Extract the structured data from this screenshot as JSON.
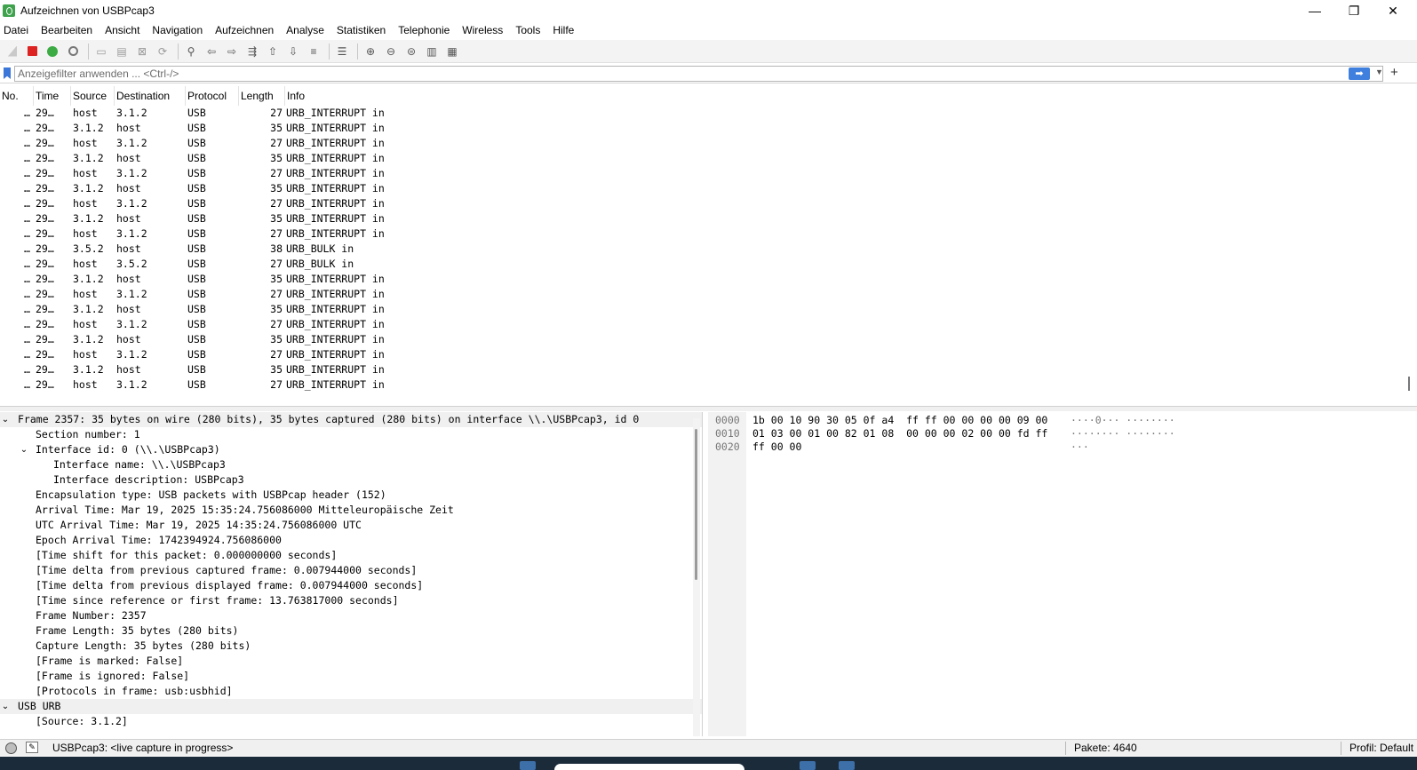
{
  "window": {
    "title": "Aufzeichnen von USBPcap3",
    "minimize": "—",
    "maximize": "❐",
    "close": "✕"
  },
  "menu": [
    "Datei",
    "Bearbeiten",
    "Ansicht",
    "Navigation",
    "Aufzeichnen",
    "Analyse",
    "Statistiken",
    "Telephonie",
    "Wireless",
    "Tools",
    "Hilfe"
  ],
  "filter": {
    "placeholder": "Anzeigefilter anwenden ... <Ctrl-/>",
    "apply": "➡",
    "dropdown": "▼",
    "add": "+"
  },
  "packet_list": {
    "columns": [
      "No.",
      "Time",
      "Source",
      "Destination",
      "Protocol",
      "Length",
      "Info"
    ],
    "rows": [
      {
        "no": "…",
        "time": "29…",
        "src": "host",
        "dst": "3.1.2",
        "proto": "USB",
        "len": "27",
        "info": "URB_INTERRUPT in"
      },
      {
        "no": "…",
        "time": "29…",
        "src": "3.1.2",
        "dst": "host",
        "proto": "USB",
        "len": "35",
        "info": "URB_INTERRUPT in"
      },
      {
        "no": "…",
        "time": "29…",
        "src": "host",
        "dst": "3.1.2",
        "proto": "USB",
        "len": "27",
        "info": "URB_INTERRUPT in"
      },
      {
        "no": "…",
        "time": "29…",
        "src": "3.1.2",
        "dst": "host",
        "proto": "USB",
        "len": "35",
        "info": "URB_INTERRUPT in"
      },
      {
        "no": "…",
        "time": "29…",
        "src": "host",
        "dst": "3.1.2",
        "proto": "USB",
        "len": "27",
        "info": "URB_INTERRUPT in"
      },
      {
        "no": "…",
        "time": "29…",
        "src": "3.1.2",
        "dst": "host",
        "proto": "USB",
        "len": "35",
        "info": "URB_INTERRUPT in"
      },
      {
        "no": "…",
        "time": "29…",
        "src": "host",
        "dst": "3.1.2",
        "proto": "USB",
        "len": "27",
        "info": "URB_INTERRUPT in"
      },
      {
        "no": "…",
        "time": "29…",
        "src": "3.1.2",
        "dst": "host",
        "proto": "USB",
        "len": "35",
        "info": "URB_INTERRUPT in"
      },
      {
        "no": "…",
        "time": "29…",
        "src": "host",
        "dst": "3.1.2",
        "proto": "USB",
        "len": "27",
        "info": "URB_INTERRUPT in"
      },
      {
        "no": "…",
        "time": "29…",
        "src": "3.5.2",
        "dst": "host",
        "proto": "USB",
        "len": "38",
        "info": "URB_BULK in"
      },
      {
        "no": "…",
        "time": "29…",
        "src": "host",
        "dst": "3.5.2",
        "proto": "USB",
        "len": "27",
        "info": "URB_BULK in"
      },
      {
        "no": "…",
        "time": "29…",
        "src": "3.1.2",
        "dst": "host",
        "proto": "USB",
        "len": "35",
        "info": "URB_INTERRUPT in"
      },
      {
        "no": "…",
        "time": "29…",
        "src": "host",
        "dst": "3.1.2",
        "proto": "USB",
        "len": "27",
        "info": "URB_INTERRUPT in"
      },
      {
        "no": "…",
        "time": "29…",
        "src": "3.1.2",
        "dst": "host",
        "proto": "USB",
        "len": "35",
        "info": "URB_INTERRUPT in"
      },
      {
        "no": "…",
        "time": "29…",
        "src": "host",
        "dst": "3.1.2",
        "proto": "USB",
        "len": "27",
        "info": "URB_INTERRUPT in"
      },
      {
        "no": "…",
        "time": "29…",
        "src": "3.1.2",
        "dst": "host",
        "proto": "USB",
        "len": "35",
        "info": "URB_INTERRUPT in"
      },
      {
        "no": "…",
        "time": "29…",
        "src": "host",
        "dst": "3.1.2",
        "proto": "USB",
        "len": "27",
        "info": "URB_INTERRUPT in"
      },
      {
        "no": "…",
        "time": "29…",
        "src": "3.1.2",
        "dst": "host",
        "proto": "USB",
        "len": "35",
        "info": "URB_INTERRUPT in"
      },
      {
        "no": "…",
        "time": "29…",
        "src": "host",
        "dst": "3.1.2",
        "proto": "USB",
        "len": "27",
        "info": "URB_INTERRUPT in"
      }
    ]
  },
  "details": [
    {
      "level": 0,
      "arrow": "v",
      "text": "Frame 2357: 35 bytes on wire (280 bits), 35 bytes captured (280 bits) on interface \\\\.\\USBPcap3, id 0"
    },
    {
      "level": 2,
      "arrow": "",
      "text": "Section number: 1"
    },
    {
      "level": 1,
      "arrow": "v",
      "text": "Interface id: 0 (\\\\.\\USBPcap3)"
    },
    {
      "level": 3,
      "arrow": "",
      "text": "Interface name: \\\\.\\USBPcap3"
    },
    {
      "level": 3,
      "arrow": "",
      "text": "Interface description: USBPcap3"
    },
    {
      "level": 2,
      "arrow": "",
      "text": "Encapsulation type: USB packets with USBPcap header (152)"
    },
    {
      "level": 2,
      "arrow": "",
      "text": "Arrival Time: Mar 19, 2025 15:35:24.756086000 Mitteleuropäische Zeit"
    },
    {
      "level": 2,
      "arrow": "",
      "text": "UTC Arrival Time: Mar 19, 2025 14:35:24.756086000 UTC"
    },
    {
      "level": 2,
      "arrow": "",
      "text": "Epoch Arrival Time: 1742394924.756086000"
    },
    {
      "level": 2,
      "arrow": "",
      "text": "[Time shift for this packet: 0.000000000 seconds]"
    },
    {
      "level": 2,
      "arrow": "",
      "text": "[Time delta from previous captured frame: 0.007944000 seconds]"
    },
    {
      "level": 2,
      "arrow": "",
      "text": "[Time delta from previous displayed frame: 0.007944000 seconds]"
    },
    {
      "level": 2,
      "arrow": "",
      "text": "[Time since reference or first frame: 13.763817000 seconds]"
    },
    {
      "level": 2,
      "arrow": "",
      "text": "Frame Number: 2357"
    },
    {
      "level": 2,
      "arrow": "",
      "text": "Frame Length: 35 bytes (280 bits)"
    },
    {
      "level": 2,
      "arrow": "",
      "text": "Capture Length: 35 bytes (280 bits)"
    },
    {
      "level": 2,
      "arrow": "",
      "text": "[Frame is marked: False]"
    },
    {
      "level": 2,
      "arrow": "",
      "text": "[Frame is ignored: False]"
    },
    {
      "level": 2,
      "arrow": "",
      "text": "[Protocols in frame: usb:usbhid]"
    },
    {
      "level": 0,
      "arrow": "v",
      "text": "USB URB"
    },
    {
      "level": 2,
      "arrow": "",
      "text": "[Source: 3.1.2]"
    }
  ],
  "hex": [
    {
      "offset": "0000",
      "bytes": "1b 00 10 90 30 05 0f a4  ff ff 00 00 00 00 09 00",
      "ascii": "····0··· ········"
    },
    {
      "offset": "0010",
      "bytes": "01 03 00 01 00 82 01 08  00 00 00 02 00 00 fd ff",
      "ascii": "········ ········"
    },
    {
      "offset": "0020",
      "bytes": "ff 00 00",
      "ascii": "···"
    }
  ],
  "status": {
    "message": "USBPcap3: <live capture in progress>",
    "packets": "Pakete: 4640",
    "profile": "Profil: Default"
  },
  "colors": {
    "accent": "#3f7fde",
    "stop": "#dd2222",
    "taskbar": "#1c2b3a"
  }
}
